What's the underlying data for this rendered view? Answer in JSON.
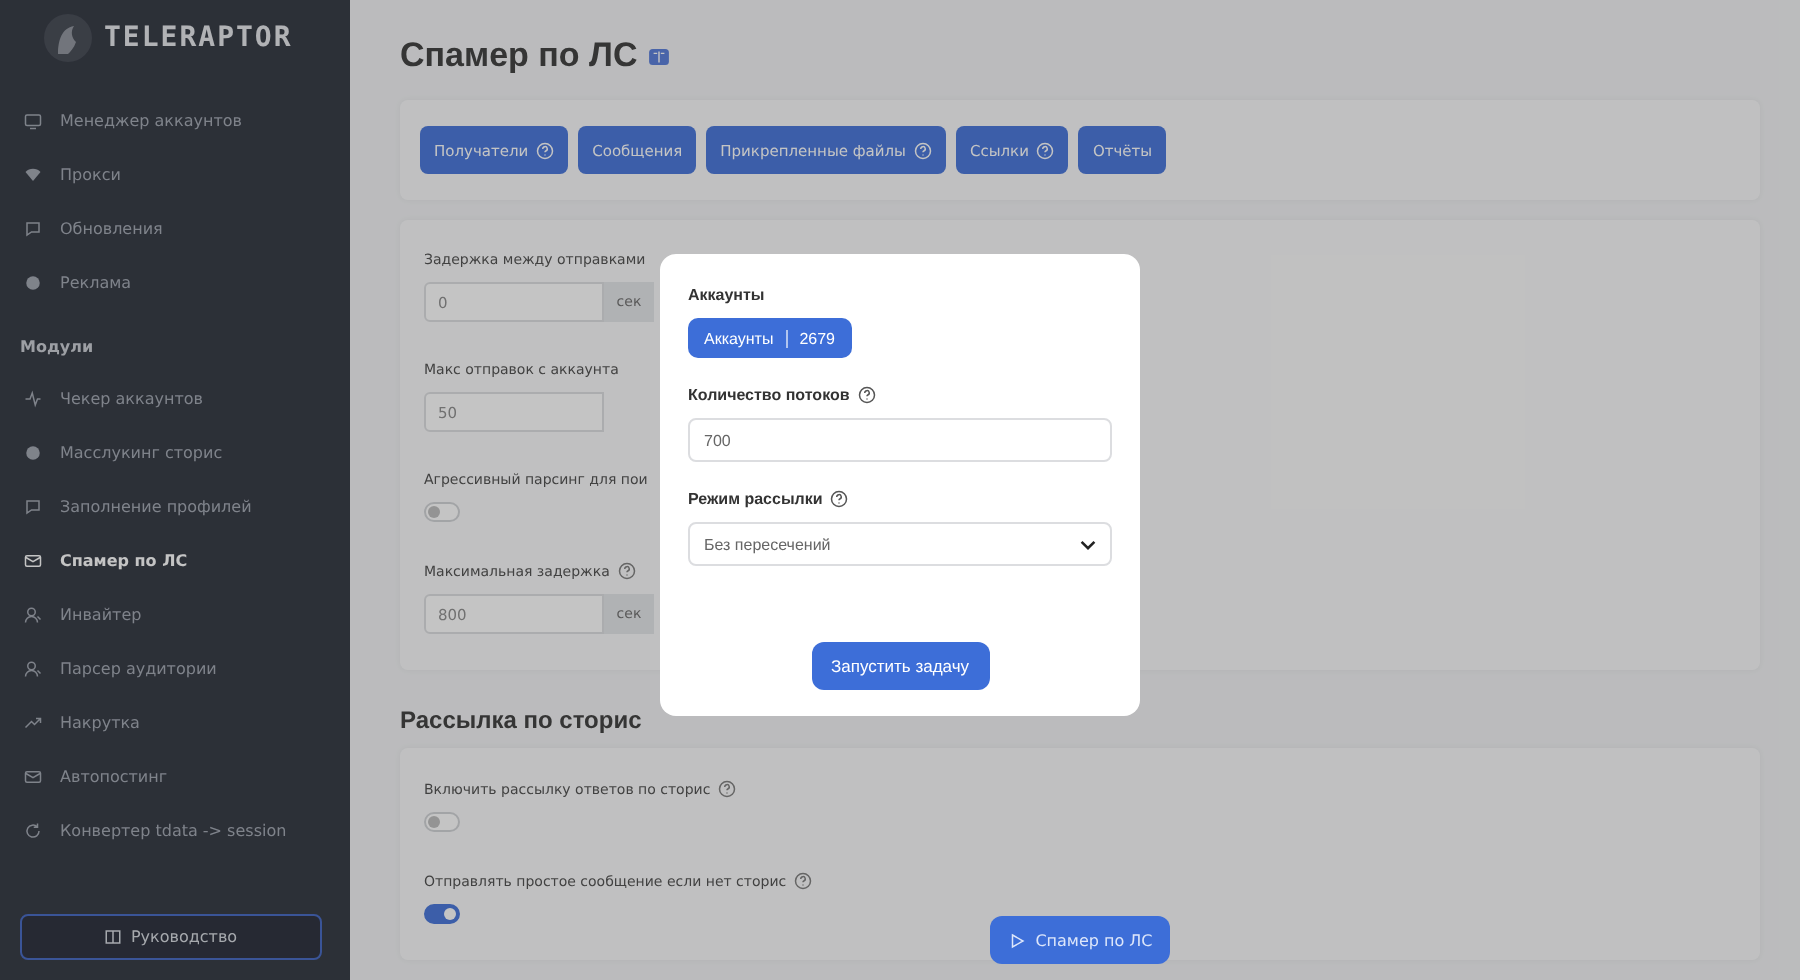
{
  "sidebar": {
    "logo_text": "TELERAPTOR",
    "items": [
      {
        "kind": "item",
        "label": "Менеджер аккаунтов",
        "selected": false
      },
      {
        "kind": "item",
        "label": "Прокси",
        "selected": false
      },
      {
        "kind": "item",
        "label": "Обновления",
        "selected": false
      },
      {
        "kind": "item",
        "label": "Реклама",
        "selected": false
      },
      {
        "kind": "heading",
        "label": "Модули"
      },
      {
        "kind": "item",
        "label": "Чекер аккаунтов",
        "selected": false
      },
      {
        "kind": "item",
        "label": "Масслукинг сторис",
        "selected": false
      },
      {
        "kind": "item",
        "label": "Заполнение профилей",
        "selected": false
      },
      {
        "kind": "item",
        "label": "Спамер по ЛС",
        "selected": true
      },
      {
        "kind": "item",
        "label": "Инвайтер",
        "selected": false
      },
      {
        "kind": "item",
        "label": "Парсер аудитории",
        "selected": false
      },
      {
        "kind": "item",
        "label": "Накрутка",
        "selected": false
      },
      {
        "kind": "item",
        "label": "Автопостинг",
        "selected": false
      },
      {
        "kind": "item",
        "label": "Конвертер tdata -> session",
        "selected": false
      }
    ],
    "guide_button": "Руководство"
  },
  "page_title": "Спамер по ЛС",
  "tabs": [
    {
      "label": "Получатели",
      "help": true
    },
    {
      "label": "Сообщения",
      "help": false
    },
    {
      "label": "Прикрепленные файлы",
      "help": true
    },
    {
      "label": "Ссылки",
      "help": true
    },
    {
      "label": "Отчёты",
      "help": false
    }
  ],
  "settings": [
    {
      "kind": "input",
      "label": "Задержка между отправками",
      "help": false,
      "value": "0",
      "unit": "сек"
    },
    {
      "kind": "input",
      "label": "Макс отправок с аккаунта",
      "help": false,
      "value": "50"
    },
    {
      "kind": "toggle",
      "label": "Агрессивный парсинг для пои",
      "help": false,
      "on": false
    },
    {
      "kind": "input",
      "label": "Максимальная задержка",
      "help": true,
      "value": "800",
      "unit": "сек"
    }
  ],
  "stories_section": {
    "title": "Рассылка по сторис",
    "settings": [
      {
        "kind": "toggle",
        "label": "Включить рассылку ответов по сторис",
        "help": true,
        "on": false
      },
      {
        "kind": "toggle",
        "label": "Отправлять простое сообщение если нет сторис",
        "help": true,
        "on": true
      }
    ]
  },
  "float_button": "Спамер по ЛС",
  "modal": {
    "accounts_label": "Аккаунты",
    "accounts_button": {
      "label": "Аккаунты",
      "count": "2679"
    },
    "threads_label": "Количество потоков",
    "threads_value": "700",
    "mode_label": "Режим рассылки",
    "mode_value": "Без пересечений",
    "submit": "Запустить задачу"
  }
}
